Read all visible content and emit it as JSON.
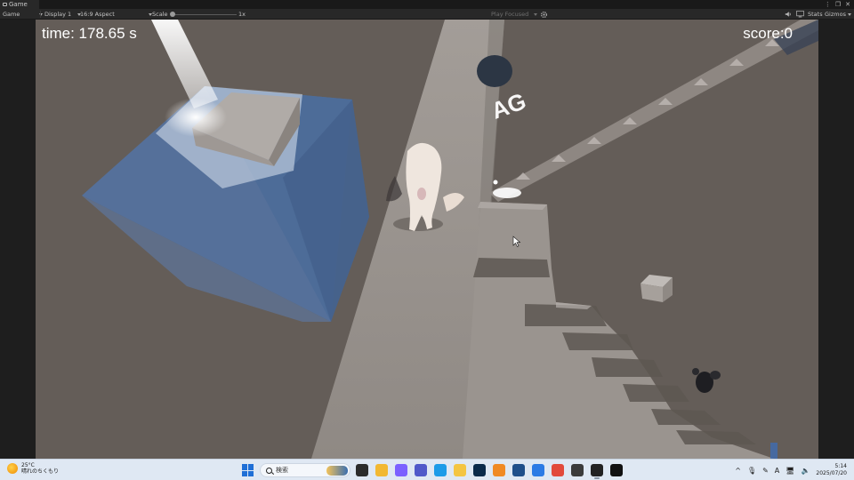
{
  "tab": {
    "title": "Game"
  },
  "toolbar": {
    "view_mode": "Game",
    "display": "Display 1",
    "aspect": "16:9 Aspect",
    "scale_label": "Scale",
    "scale_value": "1x",
    "play_mode": "Play Focused",
    "stats_label": "Stats",
    "gizmos_label": "Gizmos"
  },
  "hud": {
    "time_text": "time: 178.65 s",
    "score_text": "score:0"
  },
  "taskbar": {
    "weather_temp": "25°C",
    "weather_desc": "晴れのちくもり",
    "search_placeholder": "検索",
    "time": "5:14",
    "date": "2025/07/20",
    "apps": [
      {
        "name": "task-view-icon",
        "color": "#2b2b2b"
      },
      {
        "name": "file-explorer-icon",
        "color": "#f2b832"
      },
      {
        "name": "copilot-icon",
        "color": "#7b61ff"
      },
      {
        "name": "teams-icon",
        "color": "#5059c9"
      },
      {
        "name": "edge-icon",
        "color": "#1c9be8"
      },
      {
        "name": "folder-icon",
        "color": "#f4c542"
      },
      {
        "name": "photoshop-icon",
        "color": "#0a2a4a"
      },
      {
        "name": "vlc-icon",
        "color": "#f08a24"
      },
      {
        "name": "calculator-icon",
        "color": "#1f4f8a"
      },
      {
        "name": "photos-icon",
        "color": "#2c7be5"
      },
      {
        "name": "chrome-icon",
        "color": "#e24a3b"
      },
      {
        "name": "unity-hub-icon",
        "color": "#3b3b3b"
      },
      {
        "name": "unity-editor-icon",
        "color": "#222222"
      },
      {
        "name": "github-icon",
        "color": "#111111"
      }
    ]
  },
  "colors": {
    "floor": "#6b645e",
    "stone": "#a19b97",
    "water_cube": "#5a78a4",
    "accent": "#1f6fd6"
  }
}
